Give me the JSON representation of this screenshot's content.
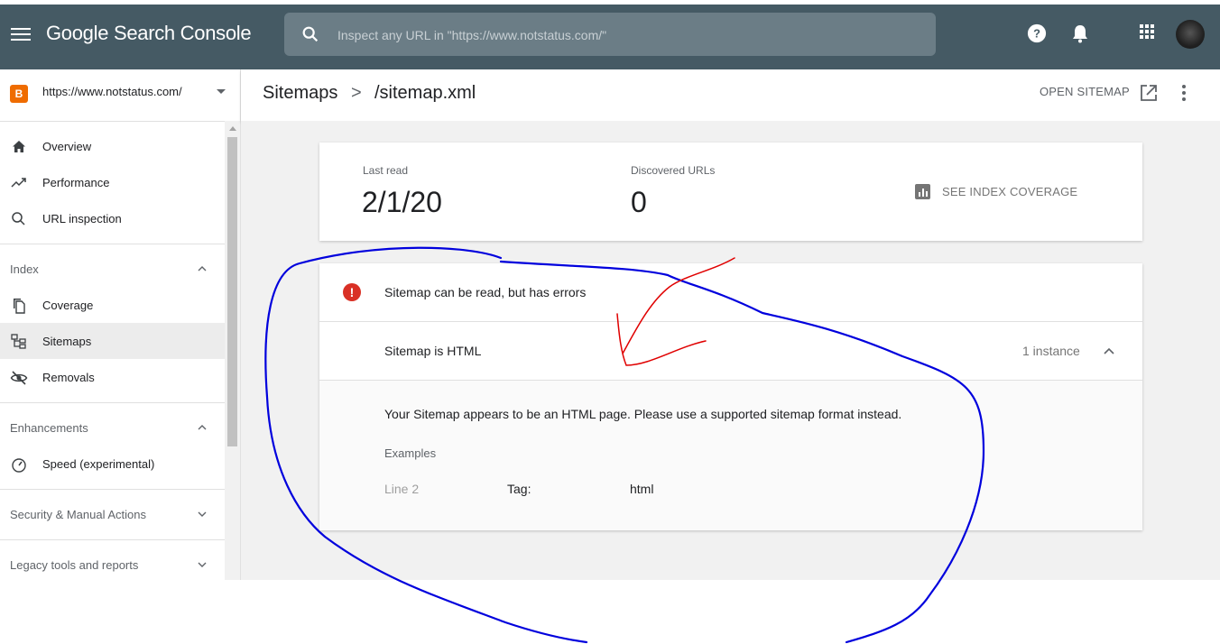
{
  "app": {
    "title": "Google Search Console"
  },
  "search": {
    "placeholder": "Inspect any URL in \"https://www.notstatus.com/\""
  },
  "property": {
    "url": "https://www.notstatus.com/",
    "icon": "blogger-icon",
    "icon_letter": "B"
  },
  "nav": {
    "items": [
      {
        "label": "Overview",
        "icon": "home-icon"
      },
      {
        "label": "Performance",
        "icon": "trending-up-icon"
      },
      {
        "label": "URL inspection",
        "icon": "search-icon"
      }
    ],
    "index": {
      "label": "Index",
      "items": [
        {
          "label": "Coverage",
          "icon": "copy-icon"
        },
        {
          "label": "Sitemaps",
          "icon": "sitemap-icon",
          "active": true
        },
        {
          "label": "Removals",
          "icon": "visibility-off-icon"
        }
      ]
    },
    "enhancements": {
      "label": "Enhancements",
      "items": [
        {
          "label": "Speed (experimental)",
          "icon": "speed-icon"
        }
      ]
    },
    "security": {
      "label": "Security & Manual Actions"
    },
    "legacy": {
      "label": "Legacy tools and reports"
    }
  },
  "header": {
    "breadcrumb_parent": "Sitemaps",
    "breadcrumb_separator": ">",
    "breadcrumb_current": "/sitemap.xml",
    "open_sitemap": "OPEN SITEMAP"
  },
  "summary": {
    "last_read_label": "Last read",
    "last_read_value": "2/1/20",
    "discovered_label": "Discovered URLs",
    "discovered_value": "0",
    "see_index_coverage": "SEE INDEX COVERAGE"
  },
  "status": {
    "message": "Sitemap can be read, but has errors",
    "issue": "Sitemap is HTML",
    "instances": "1 instance",
    "description": "Your Sitemap appears to be an HTML page. Please use a supported sitemap format instead.",
    "examples_label": "Examples",
    "example": {
      "line": "Line 2",
      "tag_label": "Tag:",
      "tag_value": "html"
    }
  },
  "colors": {
    "topbar": "#455a64",
    "error": "#d93025",
    "annotation_red": "#e00000",
    "annotation_blue": "#0000dd"
  }
}
